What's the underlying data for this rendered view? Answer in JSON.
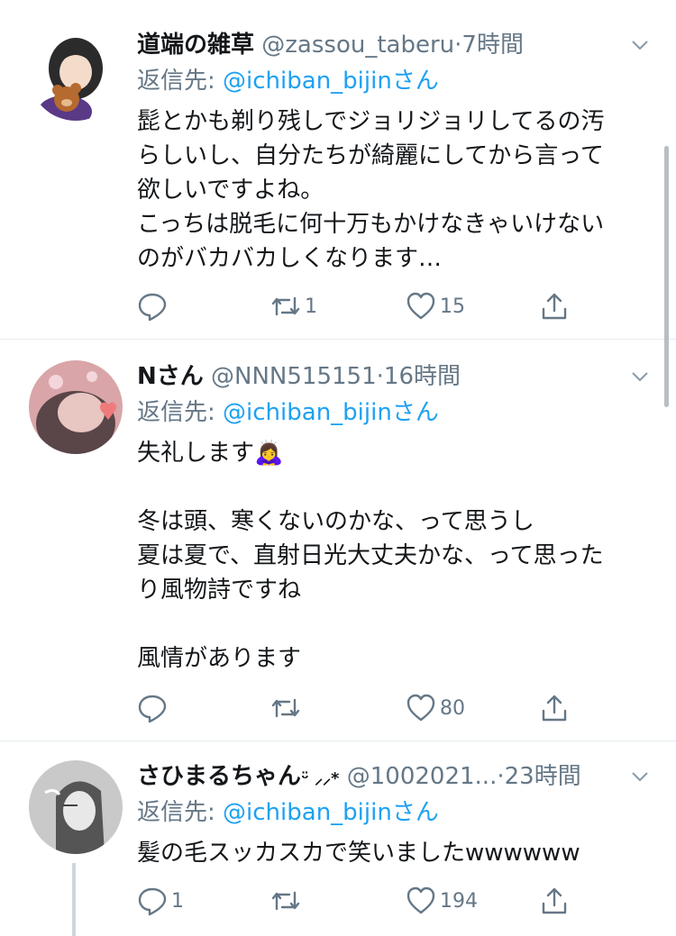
{
  "tweets": [
    {
      "name": "道端の雑草",
      "handle": "@zassou_taberu",
      "dot": "·",
      "time": "7時間",
      "reply_prefix": "返信先: ",
      "reply_to": "@ichiban_bijinさん",
      "text": "髭とかも剃り残しでジョリジョリしてるの汚\nらしいし、自分たちが綺麗にしてから言って\n欲しいですよね。\nこっちは脱毛に何十万もかけなきゃいけない\nのがバカバカしくなります…",
      "retweets": "1",
      "likes": "15",
      "avatar_icon": "avatar-girl-with-bear"
    },
    {
      "name": "Nさん",
      "handle": "@NNN515151",
      "dot": "·",
      "time": "16時間",
      "reply_prefix": "返信先: ",
      "reply_to": "@ichiban_bijinさん",
      "text": "失礼します🙇‍♀️\n\n冬は頭、寒くないのかな、って思うし\n夏は夏で、直射日光大丈夫かな、って思った\nり風物詩ですね\n\n風情があります",
      "retweets": "",
      "likes": "80",
      "avatar_icon": "avatar-pink-photo"
    },
    {
      "name": "さひまるちゃん",
      "name_suffix": "ᵕ̈ ⸝⸝*",
      "handle": "@1002021...",
      "dot": "·",
      "time": "23時間",
      "reply_prefix": "返信先: ",
      "reply_to": "@ichiban_bijinさん",
      "text": "髪の毛スッカスカで笑いましたwwwwww",
      "replies": "1",
      "retweets": "",
      "likes": "194",
      "avatar_icon": "avatar-sketch-girl"
    }
  ],
  "colors": {
    "link": "#1da1f2",
    "muted": "#657786",
    "text": "#14171a",
    "divider": "#e6ecf0"
  }
}
